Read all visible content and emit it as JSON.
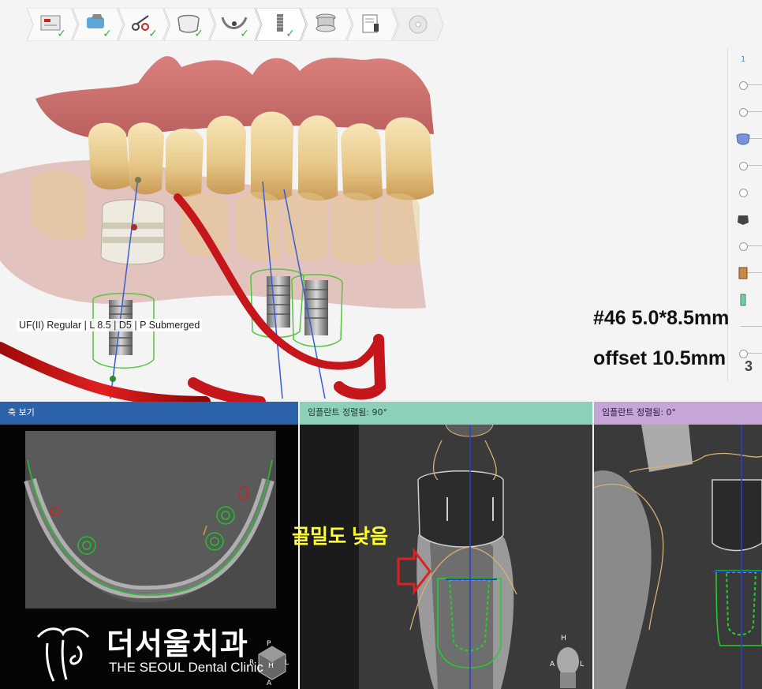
{
  "workflow": {
    "steps": [
      {
        "name": "patient-info",
        "completed": true
      },
      {
        "name": "scan-import",
        "completed": true
      },
      {
        "name": "segmentation",
        "completed": true
      },
      {
        "name": "crown-design",
        "completed": true
      },
      {
        "name": "nerve-canal",
        "completed": true
      },
      {
        "name": "implant-placement",
        "completed": true,
        "active": true
      },
      {
        "name": "sleeve-design",
        "completed": false
      },
      {
        "name": "report",
        "completed": false
      },
      {
        "name": "export",
        "completed": false,
        "disabled": true
      }
    ]
  },
  "side_toolbar": {
    "page": "1",
    "icons": [
      "tooth-crown-icon",
      "bone-icon",
      "sleeve-icon",
      "implant-icon"
    ]
  },
  "implant_info": "UF(II) Regular | L 8.5 | D5 | P Submerged",
  "annotations": {
    "spec": "#46 5.0*8.5mm",
    "offset": "offset 10.5mm",
    "digit": "3",
    "bone_density": "골밀도 낮음"
  },
  "panels": {
    "axial": {
      "title": "축 보기"
    },
    "cross": {
      "title": "임플란트 정렬됨: 90°"
    },
    "tangential": {
      "title": "임플란트 정렬됨: 0°"
    }
  },
  "orientation_axial": {
    "p": "P",
    "r": "R",
    "h": "H",
    "l": "L",
    "a": "A"
  },
  "orientation_cross": {
    "h": "H",
    "a": "A",
    "l": "L"
  },
  "logo": {
    "name": "더서울치과",
    "subtitle": "THE SEOUL Dental Clinic",
    "mark": "the"
  },
  "colors": {
    "axial_header": "#2c63a8",
    "cross_header": "#8cd0b9",
    "tangential_header": "#c6a5d8",
    "annotation_yellow": "#ffff33",
    "check_green": "#38b13a"
  }
}
